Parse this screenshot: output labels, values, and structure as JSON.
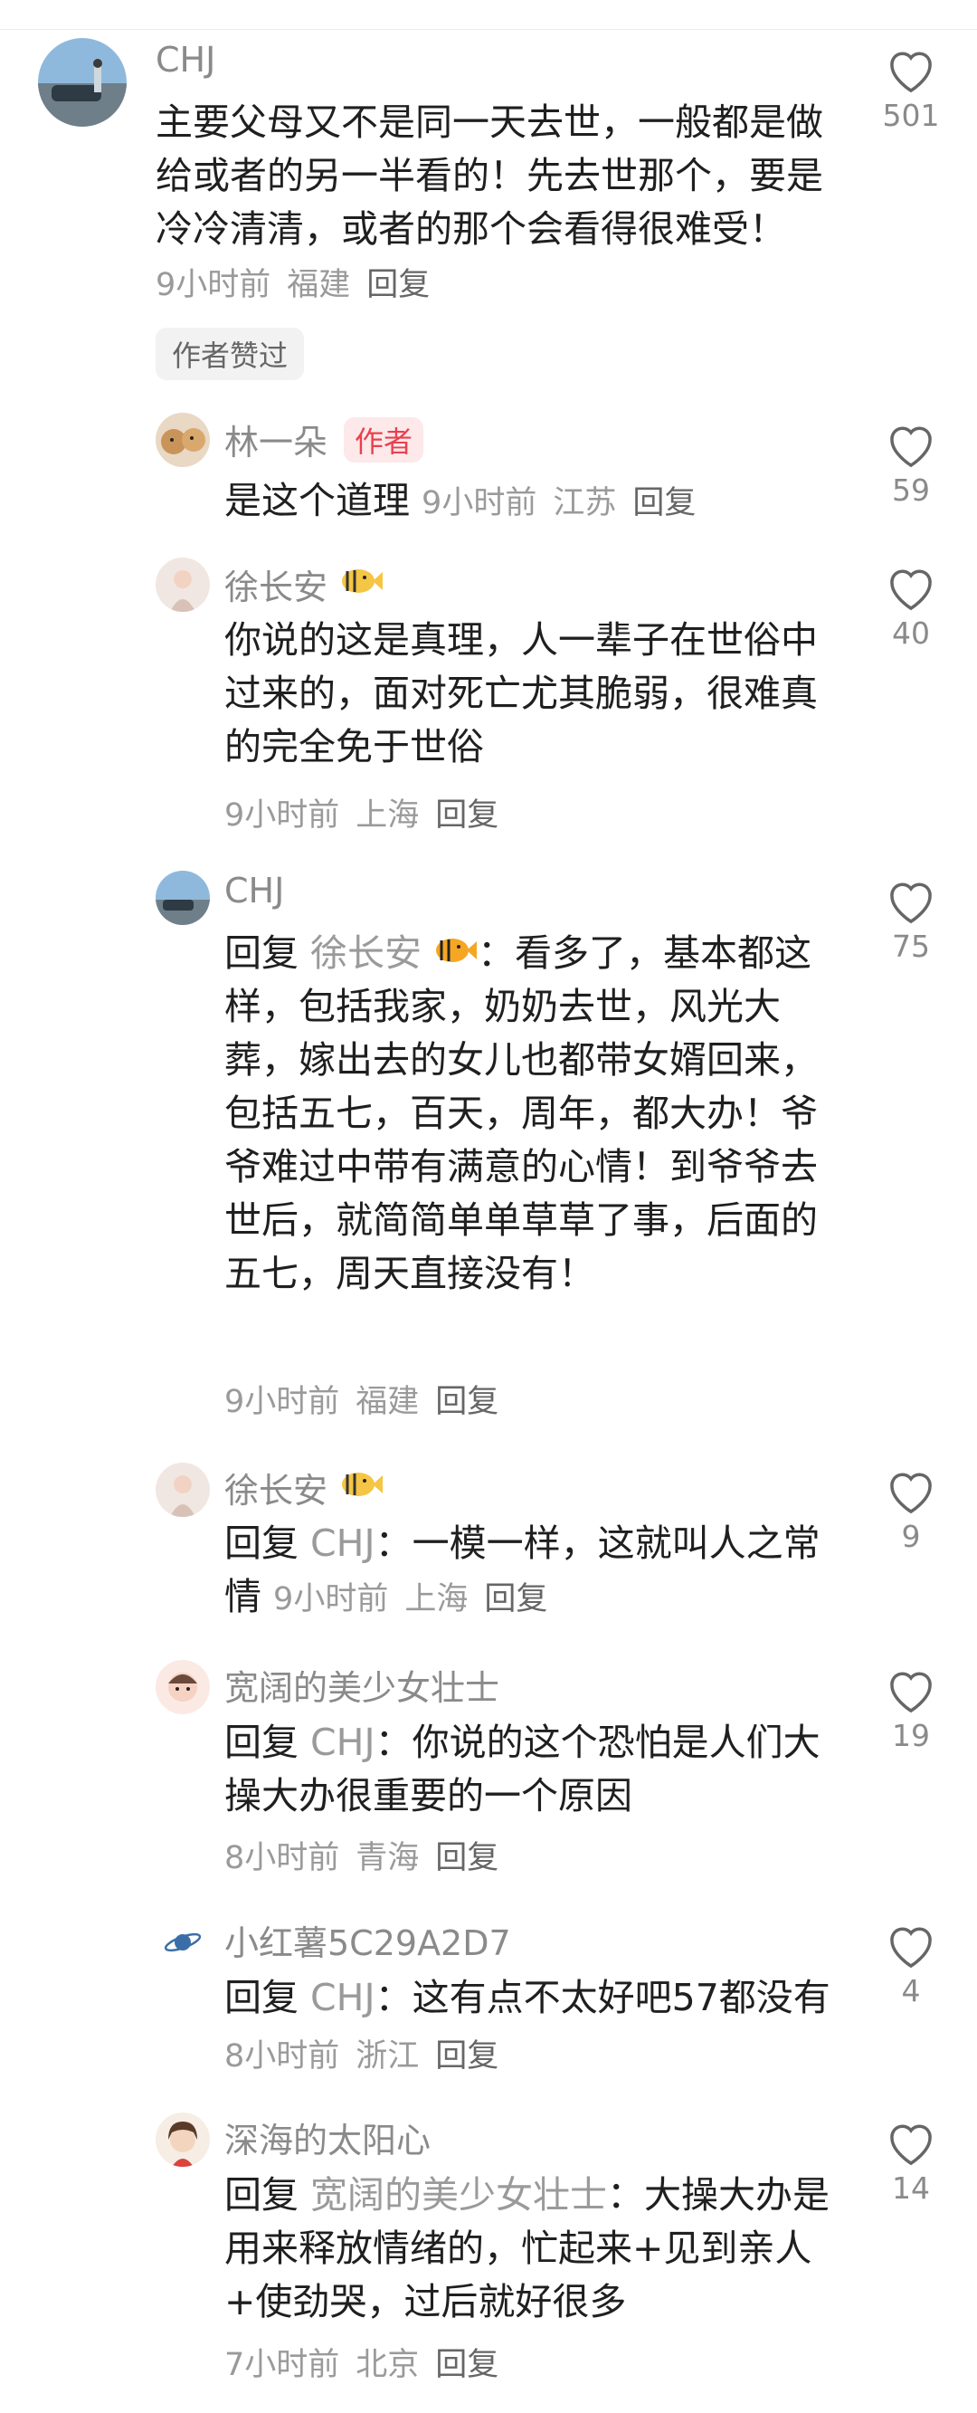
{
  "comments": [
    {
      "user": "CHJ",
      "text": "主要父母又不是同一天去世，一般都是做给或者的另一半看的！先去世那个，要是冷冷清清，或者的那个会看得很难受！",
      "time": "9小时前",
      "location": "福建",
      "reply_label": "回复",
      "likes": "501",
      "badge": "作者赞过"
    },
    {
      "user": "林一朵",
      "author_tag": "作者",
      "text": "是这个道理",
      "time": "9小时前",
      "location": "江苏",
      "reply_label": "回复",
      "likes": "59"
    },
    {
      "user": "徐长安",
      "text": "你说的这是真理，人一辈子在世俗中过来的，面对死亡尤其脆弱，很难真的完全免于世俗",
      "time": "9小时前",
      "location": "上海",
      "reply_label": "回复",
      "likes": "40"
    },
    {
      "user": "CHJ",
      "reply_prefix": "回复",
      "reply_to": "徐长安",
      "text": "：看多了，基本都这样，包括我家，奶奶去世，风光大葬，嫁出去的女儿也都带女婿回来，包括五七，百天，周年，都大办！爷爷难过中带有满意的心情！到爷爷去世后，就简简单单草草了事，后面的五七，周天直接没有！",
      "time": "9小时前",
      "location": "福建",
      "reply_label": "回复",
      "likes": "75"
    },
    {
      "user": "徐长安",
      "reply_prefix": "回复",
      "reply_to": "CHJ",
      "text": "：一模一样，这就叫人之常情",
      "time": "9小时前",
      "location": "上海",
      "reply_label": "回复",
      "likes": "9"
    },
    {
      "user": "宽阔的美少女壮士",
      "reply_prefix": "回复",
      "reply_to": "CHJ",
      "text": "：你说的这个恐怕是人们大操大办很重要的一个原因",
      "time": "8小时前",
      "location": "青海",
      "reply_label": "回复",
      "likes": "19"
    },
    {
      "user": "小红薯5C29A2D7",
      "reply_prefix": "回复",
      "reply_to": "CHJ",
      "text": "：这有点不太好吧57都没有",
      "time": "8小时前",
      "location": "浙江",
      "reply_label": "回复",
      "likes": "4"
    },
    {
      "user": "深海的太阳心",
      "reply_prefix": "回复",
      "reply_to": "宽阔的美少女壮士",
      "text": "：大操大办是用来释放情绪的，忙起来+见到亲人+使劲哭，过后就好很多",
      "time": "7小时前",
      "location": "北京",
      "reply_label": "回复",
      "likes": "14"
    }
  ],
  "icons": {
    "like": "heart-outline-icon",
    "fish": "fish-emoji-icon",
    "planet": "planet-icon"
  },
  "colors": {
    "author_badge_bg": "#fde8ea",
    "author_badge_text": "#e8414e",
    "meta": "#9a9a9a"
  }
}
